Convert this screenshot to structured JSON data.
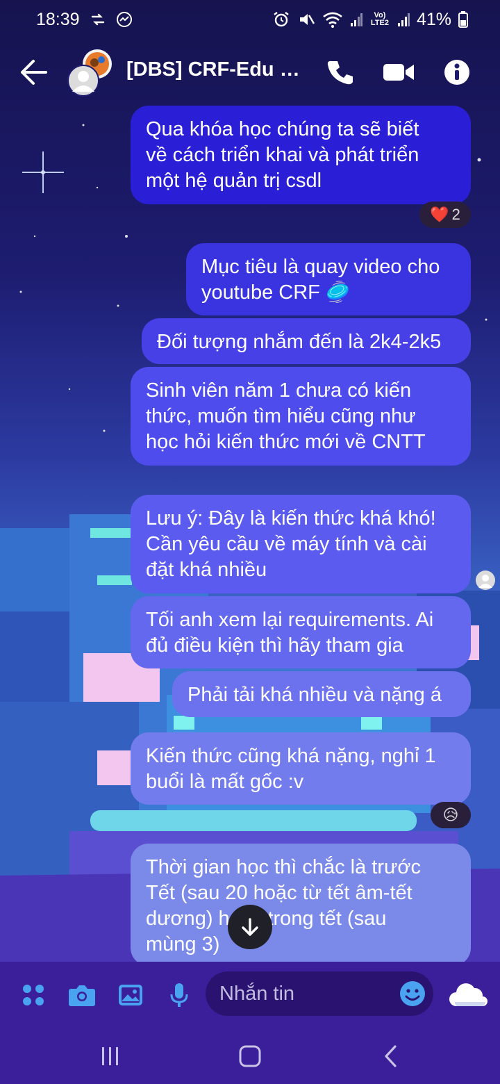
{
  "status_bar": {
    "time": "18:39",
    "network": "Vo) LTE2",
    "battery": "41%"
  },
  "header": {
    "title": "[DBS] CRF-Edu G..."
  },
  "messages": [
    {
      "text": "Qua khóa học chúng ta sẽ biết\nvề cách triển khai và phát triển\nmột hệ quản trị csdl",
      "color": "#2a1fd6"
    },
    {
      "text": "Mục tiêu là quay video cho\nyoutube CRF 🥏",
      "color": "#3a34e0"
    },
    {
      "text": "Đối tượng nhắm đến là 2k4-2k5",
      "color": "#4640e6"
    },
    {
      "text": "Sinh viên năm 1 chưa có kiến\nthức, muốn tìm hiểu cũng như\nhọc hỏi kiến thức mới về CNTT",
      "color": "#4e4cec"
    },
    {
      "text": "Lưu ý: Đây là kiến thức khá khó!\nCần yêu cầu về máy tính và cài\nđặt khá nhiều",
      "color": "#5b5cef"
    },
    {
      "text": "Tối anh xem lại requirements. Ai\nđủ điều kiện thì hãy tham gia",
      "color": "#6468ef"
    },
    {
      "text": "Phải tải khá nhiều và nặng á",
      "color": "#6c72ee"
    },
    {
      "text": "Kiến thức cũng khá nặng, nghỉ 1\nbuổi là mất gốc :v",
      "color": "#727ced"
    },
    {
      "text": "Thời gian học thì chắc là trước\nTết (sau 20 hoặc từ tết âm-tết\ndương) hoặc trong tết (sau\nmùng 3)",
      "color": "#7b8ae8"
    }
  ],
  "reactions": {
    "first": {
      "emoji": "❤️",
      "count": "2"
    },
    "second": {
      "emoji": "😥"
    }
  },
  "composer": {
    "placeholder": "Nhắn tin"
  },
  "colors": {
    "composer_bg": "#3b1f9a",
    "icon_blue": "#4aa3f0"
  }
}
